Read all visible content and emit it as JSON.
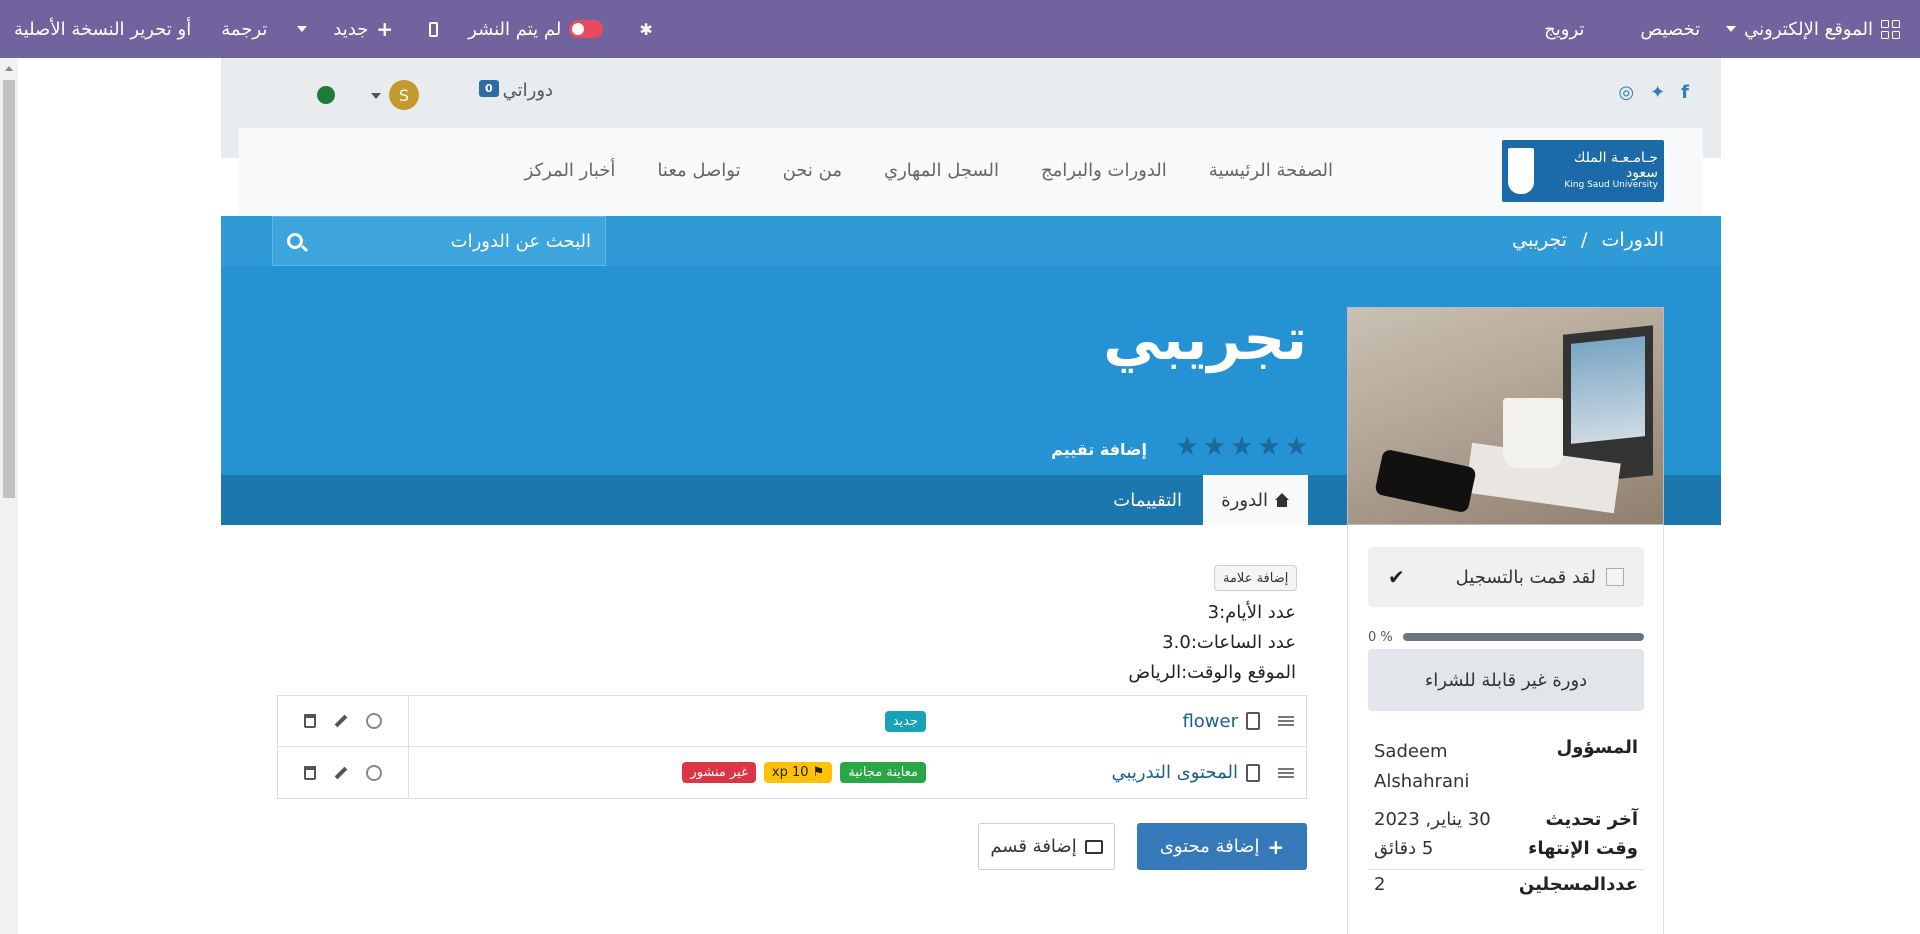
{
  "adminbar": {
    "website_menu": "الموقع الإلكتروني",
    "customize": "تخصيص",
    "promote": "ترويج",
    "unpublished": "لم يتم النشر",
    "new": "جديد",
    "translate": "ترجمة",
    "edit_original": "أو تحرير النسخة الأصلية"
  },
  "topbar": {
    "my_courses": "دوراتي",
    "cart_count": "0",
    "avatar_letter": "S"
  },
  "navbar": {
    "logo_ar": "جـامـعـة الملك سعود",
    "logo_en": "King Saud University",
    "links": [
      "الصفحة الرئيسية",
      "الدورات والبرامج",
      "السجل المهاري",
      "من نحن",
      "تواصل معنا",
      "أخبار المركز"
    ]
  },
  "breadcrumb": {
    "root": "الدورات",
    "separator": "/",
    "current": "تجريبي"
  },
  "search": {
    "placeholder": "البحث عن الدورات"
  },
  "hero": {
    "title": "تجريبي",
    "add_review": "إضافة تقييم",
    "rating": 0,
    "max_rating": 5
  },
  "tabs": {
    "course": "الدورة",
    "reviews": "التقييمات"
  },
  "sidebar": {
    "enrolled": "لقد قمت بالتسجيل",
    "progress_percent": 0,
    "progress_label": "0 %",
    "not_purchasable": "دورة غير قابلة للشراء",
    "info": [
      {
        "label": "المسؤول",
        "value": "Sadeem Alshahrani"
      },
      {
        "label": "آخر تحديث",
        "value": "30 يناير, 2023"
      },
      {
        "label": "وقت الإنتهاء",
        "value": "5 دقائق"
      },
      {
        "label": "عددالمسجلين",
        "value": "2"
      }
    ]
  },
  "main": {
    "add_tag": "إضافة علامة",
    "facts": [
      "عدد الأيام:3",
      "عدد الساعات:3.0",
      "الموقع والوقت:الرياض"
    ],
    "lessons": [
      {
        "title": "flower",
        "badges": [
          "جديد"
        ]
      },
      {
        "title": "المحتوى التدريبي",
        "badges": [
          "معاينة مجانية",
          "xp 10",
          "غير منشور"
        ]
      }
    ],
    "add_content": "إضافة محتوى",
    "add_section": "إضافة قسم"
  },
  "colors": {
    "adminbar": "#71639e",
    "primary_blue": "#2593d3",
    "tabs_blue": "#1b77ad",
    "button_blue": "#3679b8"
  }
}
